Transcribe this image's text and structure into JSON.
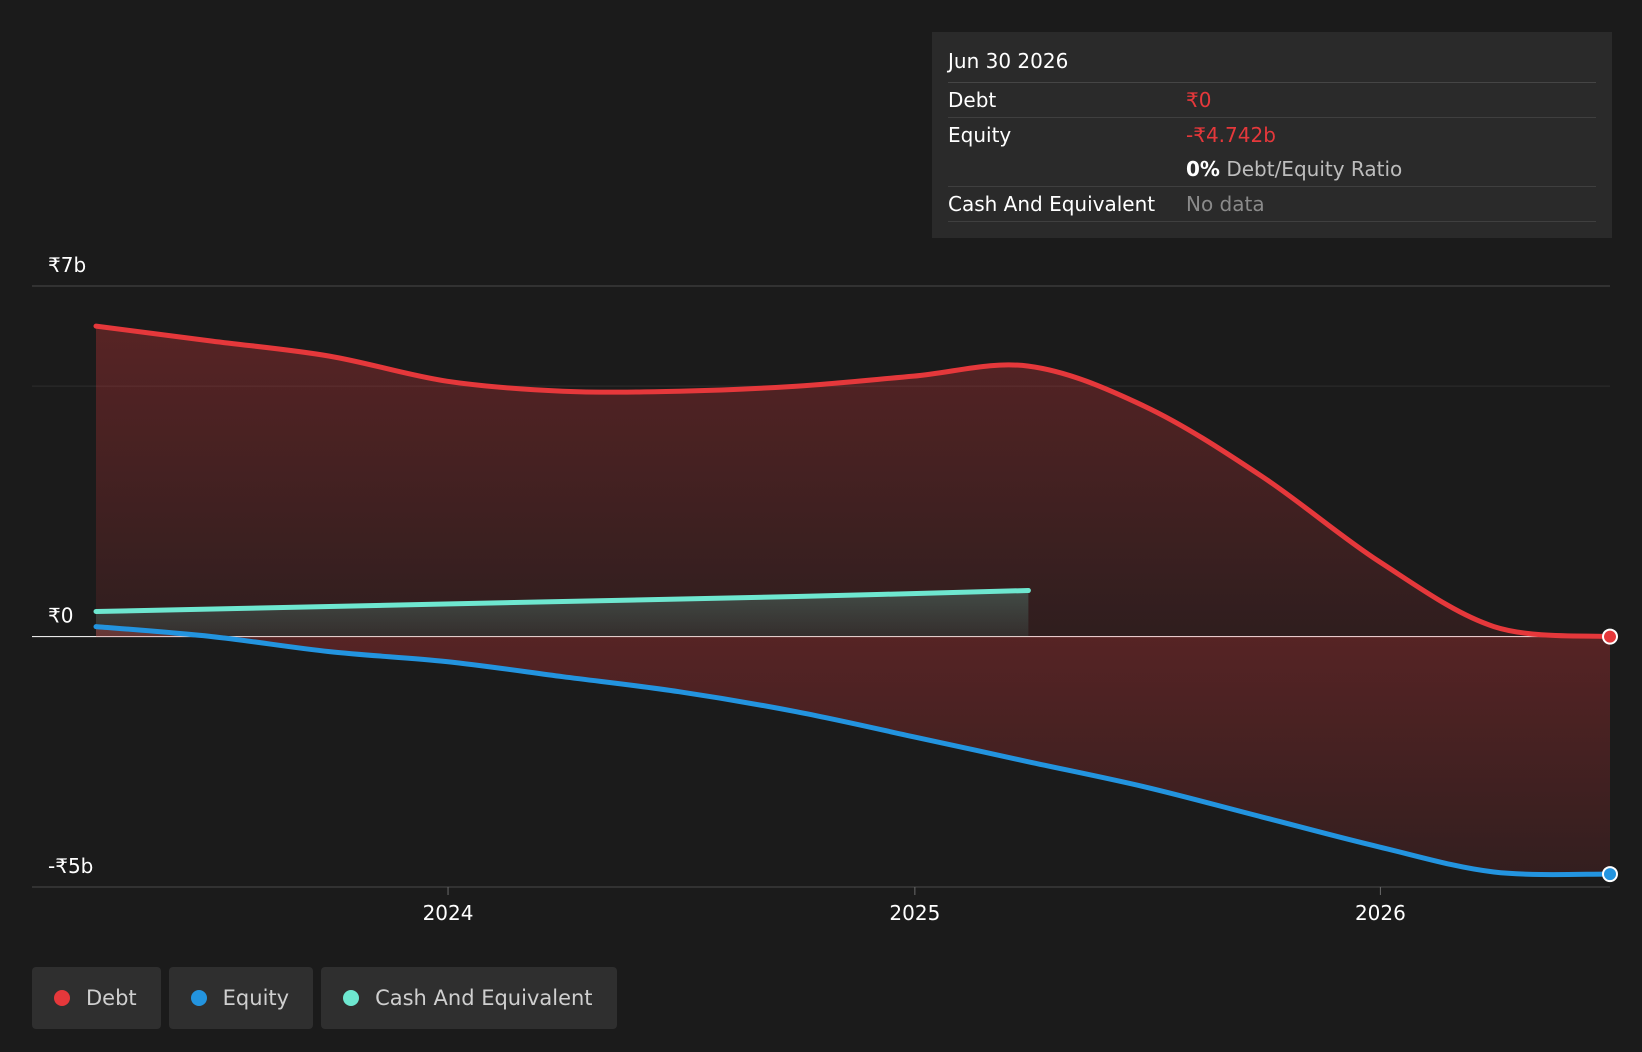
{
  "tooltip": {
    "date": "Jun 30 2026",
    "debt_label": "Debt",
    "debt_value": "₹0",
    "equity_label": "Equity",
    "equity_value": "-₹4.742b",
    "ratio_value": "0%",
    "ratio_label": "Debt/Equity Ratio",
    "cash_label": "Cash And Equivalent",
    "cash_value": "No data"
  },
  "legend": [
    {
      "label": "Debt",
      "color": "#e5383b"
    },
    {
      "label": "Equity",
      "color": "#2394df"
    },
    {
      "label": "Cash And Equivalent",
      "color": "#6ee7d0"
    }
  ],
  "chart_data": {
    "type": "area",
    "currency_unit": "₹b",
    "y_tick_labels": [
      "₹7b",
      "₹0",
      "-₹5b"
    ],
    "y_ticks": [
      7,
      0,
      -5
    ],
    "x_tick_labels": [
      "2024",
      "2025",
      "2026"
    ],
    "x_ticks": [
      "2024-01-01",
      "2025-01-01",
      "2026-01-01"
    ],
    "x_range": [
      "2023-03-31",
      "2026-06-30"
    ],
    "ylim": [
      -5,
      7
    ],
    "grid": true,
    "legend_position": "bottom-left",
    "colors": {
      "debt": "#e5383b",
      "equity": "#2394df",
      "cash": "#6ee7d0"
    },
    "series": [
      {
        "name": "Debt",
        "points": [
          {
            "x": "2023-03-31",
            "y": 6.2
          },
          {
            "x": "2023-06-30",
            "y": 5.9
          },
          {
            "x": "2023-09-30",
            "y": 5.6
          },
          {
            "x": "2023-12-31",
            "y": 5.1
          },
          {
            "x": "2024-03-31",
            "y": 4.9
          },
          {
            "x": "2024-06-30",
            "y": 4.9
          },
          {
            "x": "2024-09-30",
            "y": 5.0
          },
          {
            "x": "2024-12-31",
            "y": 5.2
          },
          {
            "x": "2025-03-31",
            "y": 5.4
          },
          {
            "x": "2025-06-30",
            "y": 4.6
          },
          {
            "x": "2025-09-30",
            "y": 3.2
          },
          {
            "x": "2025-12-31",
            "y": 1.5
          },
          {
            "x": "2026-03-31",
            "y": 0.2
          },
          {
            "x": "2026-06-30",
            "y": 0
          }
        ]
      },
      {
        "name": "Equity",
        "points": [
          {
            "x": "2023-03-31",
            "y": 0.2
          },
          {
            "x": "2023-06-30",
            "y": 0.0
          },
          {
            "x": "2023-09-30",
            "y": -0.3
          },
          {
            "x": "2023-12-31",
            "y": -0.5
          },
          {
            "x": "2024-03-31",
            "y": -0.8
          },
          {
            "x": "2024-06-30",
            "y": -1.1
          },
          {
            "x": "2024-09-30",
            "y": -1.5
          },
          {
            "x": "2024-12-31",
            "y": -2.0
          },
          {
            "x": "2025-03-31",
            "y": -2.5
          },
          {
            "x": "2025-06-30",
            "y": -3.0
          },
          {
            "x": "2025-09-30",
            "y": -3.6
          },
          {
            "x": "2025-12-31",
            "y": -4.2
          },
          {
            "x": "2026-03-31",
            "y": -4.7
          },
          {
            "x": "2026-06-30",
            "y": -4.742
          }
        ]
      },
      {
        "name": "Cash And Equivalent",
        "points": [
          {
            "x": "2023-03-31",
            "y": 0.5
          },
          {
            "x": "2023-09-30",
            "y": 0.6
          },
          {
            "x": "2024-03-31",
            "y": 0.7
          },
          {
            "x": "2024-09-30",
            "y": 0.8
          },
          {
            "x": "2025-03-31",
            "y": 0.92
          }
        ]
      }
    ]
  }
}
